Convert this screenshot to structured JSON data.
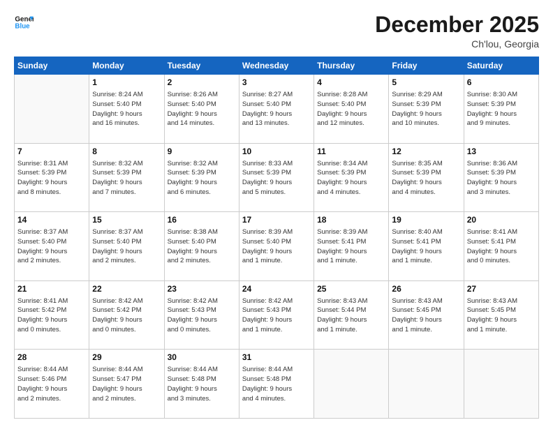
{
  "logo": {
    "line1": "General",
    "line2": "Blue"
  },
  "title": "December 2025",
  "location": "Ch'lou, Georgia",
  "header_days": [
    "Sunday",
    "Monday",
    "Tuesday",
    "Wednesday",
    "Thursday",
    "Friday",
    "Saturday"
  ],
  "weeks": [
    [
      {
        "day": "",
        "info": ""
      },
      {
        "day": "1",
        "info": "Sunrise: 8:24 AM\nSunset: 5:40 PM\nDaylight: 9 hours\nand 16 minutes."
      },
      {
        "day": "2",
        "info": "Sunrise: 8:26 AM\nSunset: 5:40 PM\nDaylight: 9 hours\nand 14 minutes."
      },
      {
        "day": "3",
        "info": "Sunrise: 8:27 AM\nSunset: 5:40 PM\nDaylight: 9 hours\nand 13 minutes."
      },
      {
        "day": "4",
        "info": "Sunrise: 8:28 AM\nSunset: 5:40 PM\nDaylight: 9 hours\nand 12 minutes."
      },
      {
        "day": "5",
        "info": "Sunrise: 8:29 AM\nSunset: 5:39 PM\nDaylight: 9 hours\nand 10 minutes."
      },
      {
        "day": "6",
        "info": "Sunrise: 8:30 AM\nSunset: 5:39 PM\nDaylight: 9 hours\nand 9 minutes."
      }
    ],
    [
      {
        "day": "7",
        "info": "Sunrise: 8:31 AM\nSunset: 5:39 PM\nDaylight: 9 hours\nand 8 minutes."
      },
      {
        "day": "8",
        "info": "Sunrise: 8:32 AM\nSunset: 5:39 PM\nDaylight: 9 hours\nand 7 minutes."
      },
      {
        "day": "9",
        "info": "Sunrise: 8:32 AM\nSunset: 5:39 PM\nDaylight: 9 hours\nand 6 minutes."
      },
      {
        "day": "10",
        "info": "Sunrise: 8:33 AM\nSunset: 5:39 PM\nDaylight: 9 hours\nand 5 minutes."
      },
      {
        "day": "11",
        "info": "Sunrise: 8:34 AM\nSunset: 5:39 PM\nDaylight: 9 hours\nand 4 minutes."
      },
      {
        "day": "12",
        "info": "Sunrise: 8:35 AM\nSunset: 5:39 PM\nDaylight: 9 hours\nand 4 minutes."
      },
      {
        "day": "13",
        "info": "Sunrise: 8:36 AM\nSunset: 5:39 PM\nDaylight: 9 hours\nand 3 minutes."
      }
    ],
    [
      {
        "day": "14",
        "info": "Sunrise: 8:37 AM\nSunset: 5:40 PM\nDaylight: 9 hours\nand 2 minutes."
      },
      {
        "day": "15",
        "info": "Sunrise: 8:37 AM\nSunset: 5:40 PM\nDaylight: 9 hours\nand 2 minutes."
      },
      {
        "day": "16",
        "info": "Sunrise: 8:38 AM\nSunset: 5:40 PM\nDaylight: 9 hours\nand 2 minutes."
      },
      {
        "day": "17",
        "info": "Sunrise: 8:39 AM\nSunset: 5:40 PM\nDaylight: 9 hours\nand 1 minute."
      },
      {
        "day": "18",
        "info": "Sunrise: 8:39 AM\nSunset: 5:41 PM\nDaylight: 9 hours\nand 1 minute."
      },
      {
        "day": "19",
        "info": "Sunrise: 8:40 AM\nSunset: 5:41 PM\nDaylight: 9 hours\nand 1 minute."
      },
      {
        "day": "20",
        "info": "Sunrise: 8:41 AM\nSunset: 5:41 PM\nDaylight: 9 hours\nand 0 minutes."
      }
    ],
    [
      {
        "day": "21",
        "info": "Sunrise: 8:41 AM\nSunset: 5:42 PM\nDaylight: 9 hours\nand 0 minutes."
      },
      {
        "day": "22",
        "info": "Sunrise: 8:42 AM\nSunset: 5:42 PM\nDaylight: 9 hours\nand 0 minutes."
      },
      {
        "day": "23",
        "info": "Sunrise: 8:42 AM\nSunset: 5:43 PM\nDaylight: 9 hours\nand 0 minutes."
      },
      {
        "day": "24",
        "info": "Sunrise: 8:42 AM\nSunset: 5:43 PM\nDaylight: 9 hours\nand 1 minute."
      },
      {
        "day": "25",
        "info": "Sunrise: 8:43 AM\nSunset: 5:44 PM\nDaylight: 9 hours\nand 1 minute."
      },
      {
        "day": "26",
        "info": "Sunrise: 8:43 AM\nSunset: 5:45 PM\nDaylight: 9 hours\nand 1 minute."
      },
      {
        "day": "27",
        "info": "Sunrise: 8:43 AM\nSunset: 5:45 PM\nDaylight: 9 hours\nand 1 minute."
      }
    ],
    [
      {
        "day": "28",
        "info": "Sunrise: 8:44 AM\nSunset: 5:46 PM\nDaylight: 9 hours\nand 2 minutes."
      },
      {
        "day": "29",
        "info": "Sunrise: 8:44 AM\nSunset: 5:47 PM\nDaylight: 9 hours\nand 2 minutes."
      },
      {
        "day": "30",
        "info": "Sunrise: 8:44 AM\nSunset: 5:48 PM\nDaylight: 9 hours\nand 3 minutes."
      },
      {
        "day": "31",
        "info": "Sunrise: 8:44 AM\nSunset: 5:48 PM\nDaylight: 9 hours\nand 4 minutes."
      },
      {
        "day": "",
        "info": ""
      },
      {
        "day": "",
        "info": ""
      },
      {
        "day": "",
        "info": ""
      }
    ]
  ]
}
